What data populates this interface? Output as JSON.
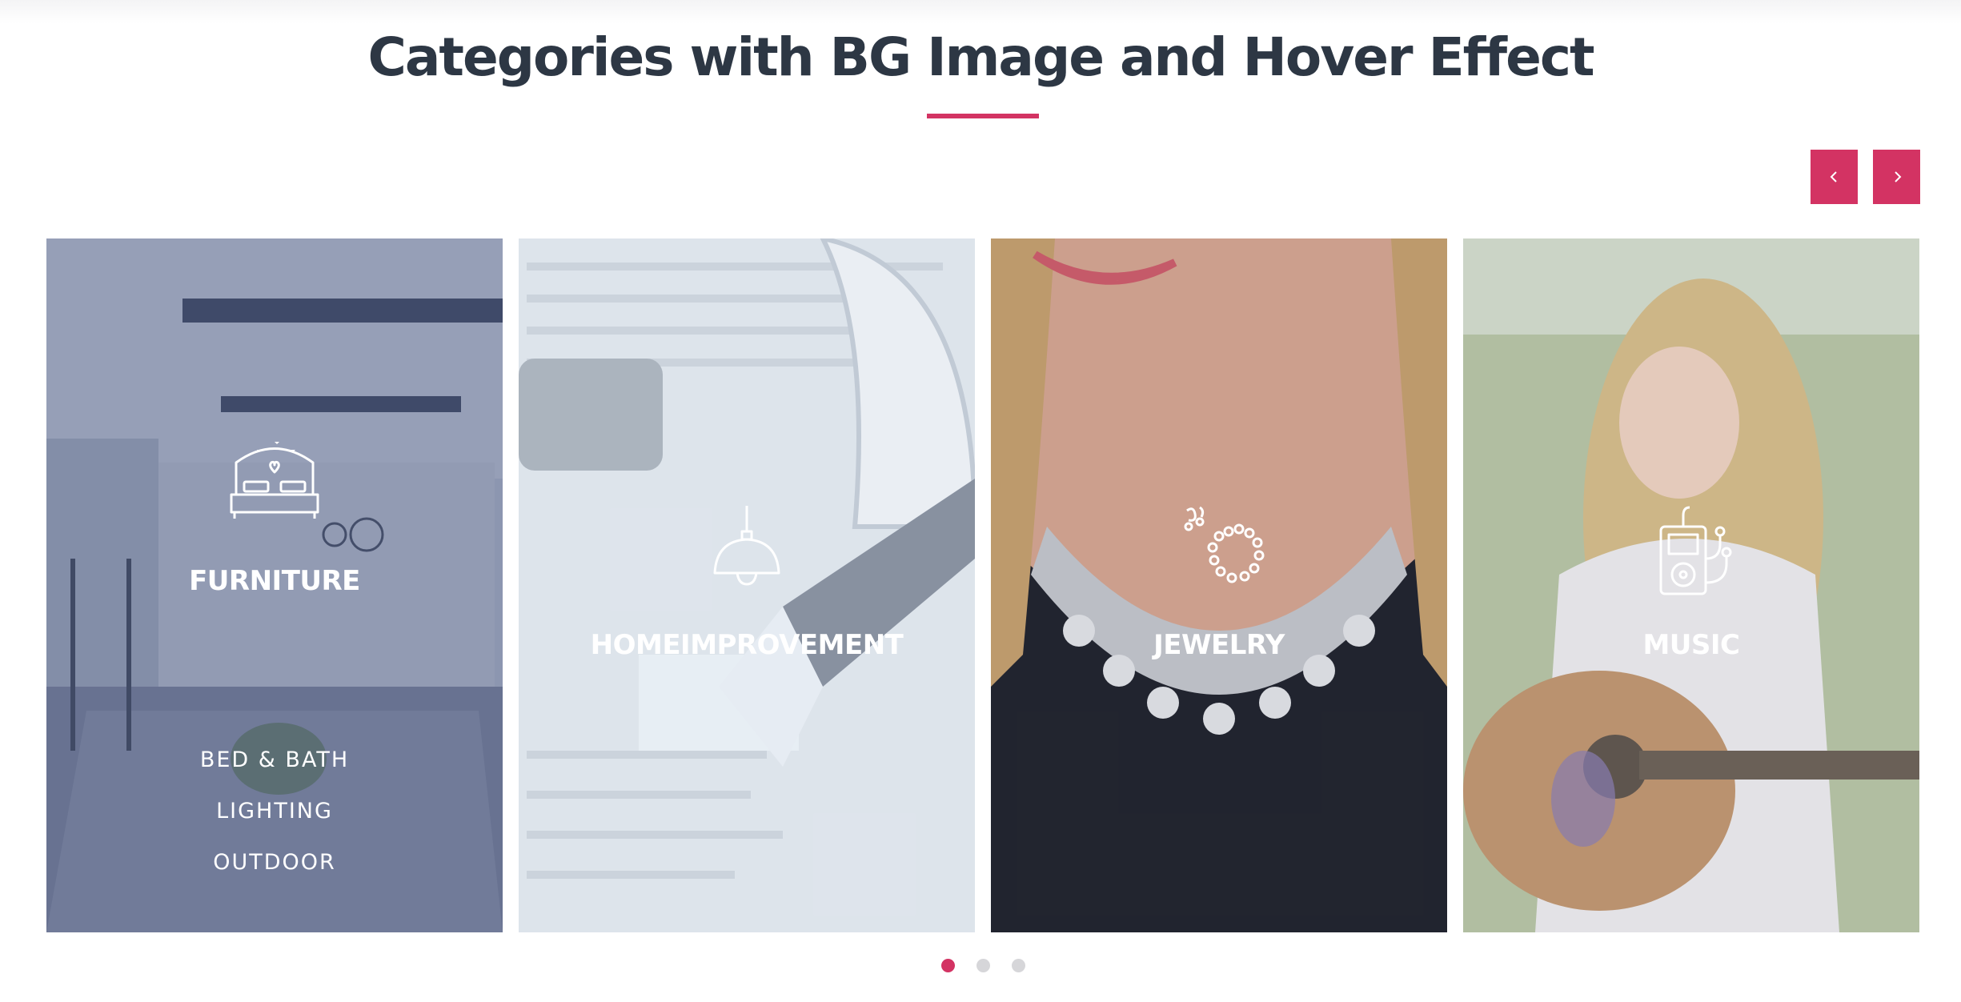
{
  "section": {
    "title": "Categories with BG Image and Hover Effect"
  },
  "carousel": {
    "prev_icon": "chevron-left-icon",
    "next_icon": "chevron-right-icon",
    "pagination": {
      "total": 3,
      "active": 1
    }
  },
  "categories": [
    {
      "title": "FURNITURE",
      "icon": "bed-icon",
      "state": "hover",
      "subcategories": [
        "BED & BATH",
        "LIGHTING",
        "OUTDOOR"
      ]
    },
    {
      "title": "HOMEIMPROVEMENT",
      "icon": "hanging-lamp-icon",
      "subcategories": []
    },
    {
      "title": "JEWELRY",
      "icon": "necklace-icon",
      "subcategories": []
    },
    {
      "title": "MUSIC",
      "icon": "music-player-icon",
      "subcategories": []
    }
  ],
  "colors": {
    "accent": "#d33363",
    "title_text": "#2d3744",
    "card_overlay_hover": "#5a6488",
    "inactive_dot": "#d6d6d9"
  }
}
